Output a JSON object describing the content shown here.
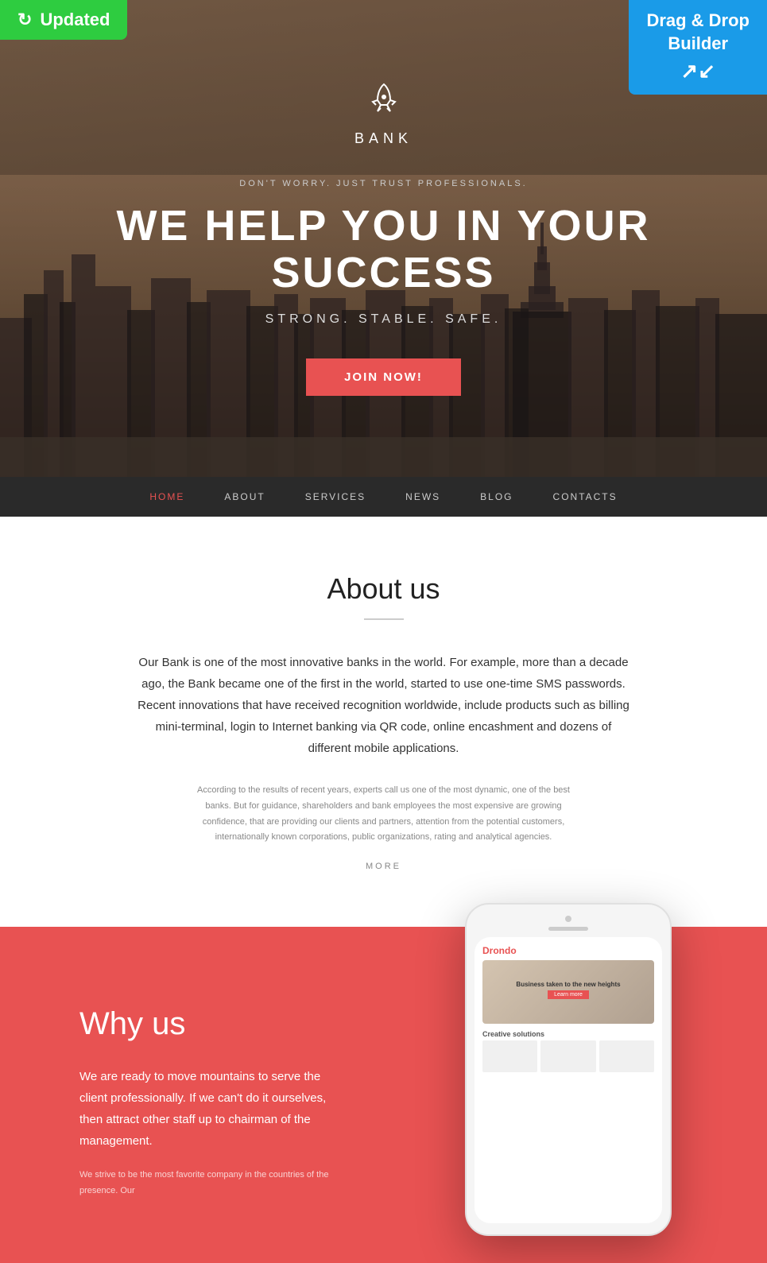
{
  "updated_badge": {
    "label": "Updated",
    "icon": "refresh-icon"
  },
  "dnd_badge": {
    "line1": "Drag & Drop",
    "line2": "Builder",
    "icon": "arrows-icon"
  },
  "hero": {
    "brand_icon": "rocket-icon",
    "brand_name": "BANK",
    "subtitle": "DON'T WORRY. JUST TRUST PROFESSIONALS.",
    "title": "WE HELP YOU IN YOUR SUCCESS",
    "tagline": "STRONG. STABLE. SAFE.",
    "cta_button": "JOIN NOW!"
  },
  "navbar": {
    "items": [
      {
        "label": "HOME",
        "active": true
      },
      {
        "label": "ABOUT",
        "active": false
      },
      {
        "label": "SERVICES",
        "active": false
      },
      {
        "label": "NEWS",
        "active": false
      },
      {
        "label": "BLOG",
        "active": false
      },
      {
        "label": "CONTACTS",
        "active": false
      }
    ]
  },
  "about": {
    "title": "About us",
    "main_text": "Our Bank is one of the most innovative banks in the world. For example, more than a decade ago, the Bank became one of the first in the world, started to use one-time SMS passwords. Recent innovations that have received recognition worldwide, include products such as billing mini-terminal, login to Internet banking via QR code, online encashment and dozens of different mobile applications.",
    "secondary_text": "According to the results of recent years, experts call us one of the most dynamic, one of the best banks. But for guidance, shareholders and bank employees the most expensive are growing confidence, that are providing our clients and partners, attention from the potential customers, internationally known corporations, public organizations, rating and analytical agencies.",
    "more_link": "MORE"
  },
  "why_us": {
    "title": "Why us",
    "main_text": "We are ready to move mountains to serve the client professionally. If we can't do it ourselves, then attract other staff up to chairman of the management.",
    "secondary_text": "We strive to be the most favorite company in the countries of the presence. Our",
    "phone": {
      "screen_logo": "Drondo",
      "screen_hero_text": "Business taken to the new heights",
      "screen_section": "Creative solutions"
    }
  }
}
